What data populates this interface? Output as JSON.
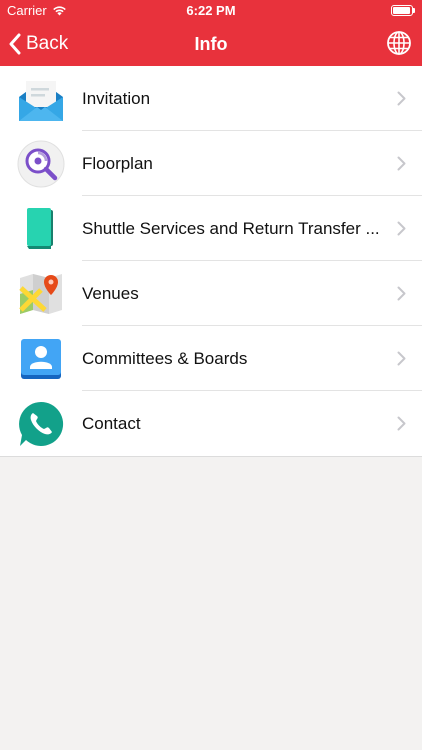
{
  "status_bar": {
    "carrier": "Carrier",
    "time": "6:22 PM"
  },
  "nav": {
    "back_label": "Back",
    "title": "Info",
    "right_icon": "globe-icon"
  },
  "items": [
    {
      "label": "Invitation",
      "icon": "envelope-icon"
    },
    {
      "label": "Floorplan",
      "icon": "magnifier-icon"
    },
    {
      "label": "Shuttle Services and Return Transfer ...",
      "icon": "cards-icon"
    },
    {
      "label": "Venues",
      "icon": "map-icon"
    },
    {
      "label": "Committees & Boards",
      "icon": "contacts-icon"
    },
    {
      "label": "Contact",
      "icon": "phone-chat-icon"
    }
  ],
  "colors": {
    "accent": "#e8323c",
    "background": "#f3f2f1"
  }
}
